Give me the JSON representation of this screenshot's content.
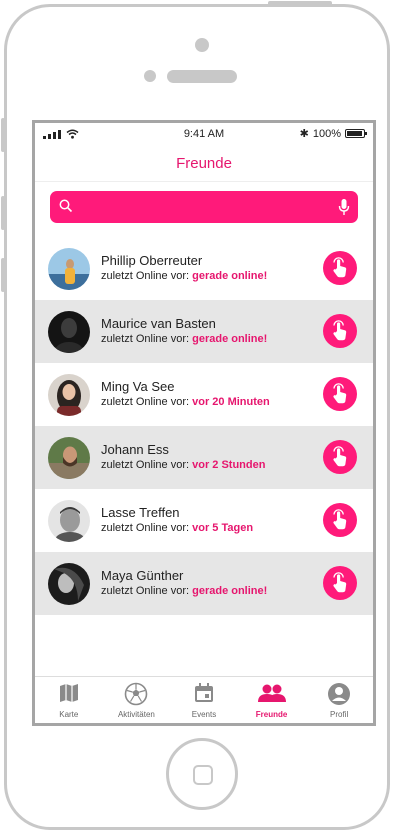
{
  "status_bar": {
    "time": "9:41 AM",
    "battery": "100%"
  },
  "header": {
    "title": "Freunde"
  },
  "search": {
    "placeholder": ""
  },
  "friends": [
    {
      "name": "Phillip Oberreuter",
      "status_prefix": "zuletzt Online vor:",
      "status_value": "gerade online!"
    },
    {
      "name": "Maurice van Basten",
      "status_prefix": "zuletzt Online vor:",
      "status_value": "gerade online!"
    },
    {
      "name": "Ming Va See",
      "status_prefix": "zuletzt Online vor:",
      "status_value": "vor 20 Minuten"
    },
    {
      "name": "Johann Ess",
      "status_prefix": "zuletzt Online vor:",
      "status_value": "vor 2 Stunden"
    },
    {
      "name": "Lasse Treffen",
      "status_prefix": "zuletzt Online vor:",
      "status_value": "vor 5 Tagen"
    },
    {
      "name": "Maya Günther",
      "status_prefix": "zuletzt Online vor:",
      "status_value": "gerade online!"
    }
  ],
  "tabs": [
    {
      "label": "Karte",
      "icon": "map-icon"
    },
    {
      "label": "Aktivitäten",
      "icon": "soccer-ball-icon"
    },
    {
      "label": "Events",
      "icon": "calendar-icon"
    },
    {
      "label": "Freunde",
      "icon": "friends-icon",
      "active": true
    },
    {
      "label": "Profil",
      "icon": "profile-icon"
    }
  ],
  "colors": {
    "accent": "#ff1a7a",
    "accent_text": "#e6166e",
    "row_shade": "#e6e6e6",
    "icon_gray": "#888888"
  }
}
